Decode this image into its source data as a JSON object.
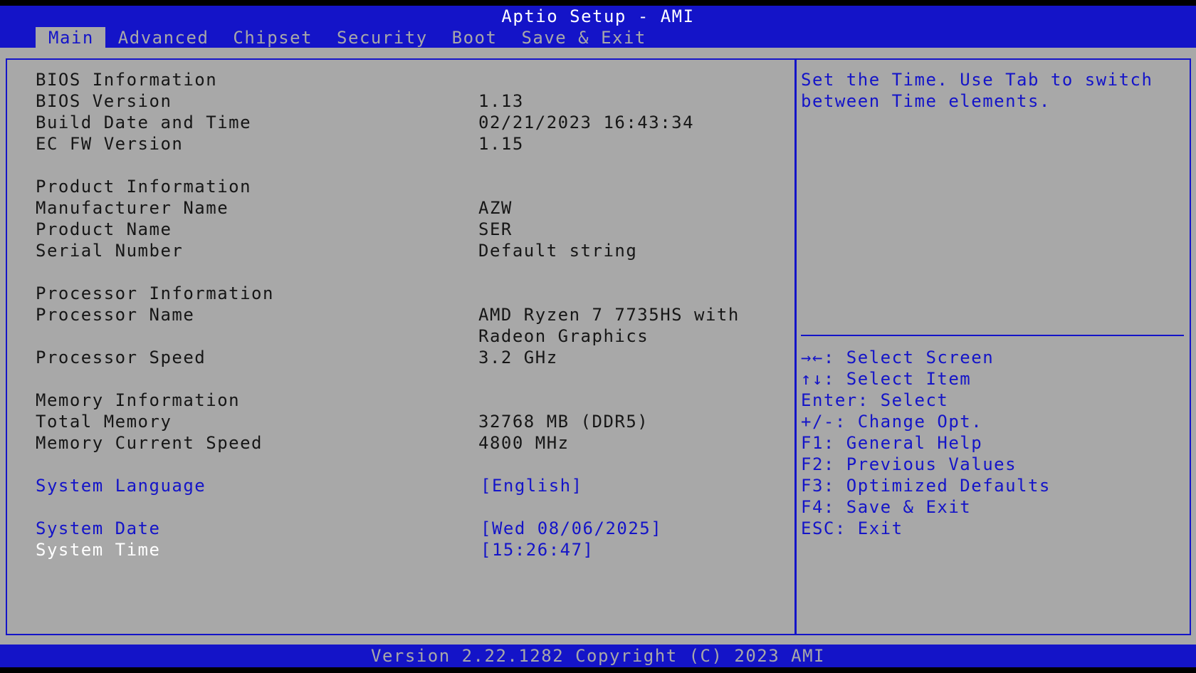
{
  "header": {
    "title": "Aptio Setup - AMI",
    "tabs": [
      "Main",
      "Advanced",
      "Chipset",
      "Security",
      "Boot",
      "Save & Exit"
    ],
    "active_tab": "Main"
  },
  "main": {
    "bios_info_heading": "BIOS Information",
    "bios_version_label": "BIOS Version",
    "bios_version_value": "1.13",
    "build_date_label": "Build Date and Time",
    "build_date_value": "02/21/2023 16:43:34",
    "ec_fw_label": "EC FW Version",
    "ec_fw_value": "1.15",
    "product_info_heading": "Product Information",
    "manufacturer_label": "Manufacturer Name",
    "manufacturer_value": "AZW",
    "product_name_label": "Product Name",
    "product_name_value": "SER",
    "serial_label": "Serial Number",
    "serial_value": "Default string",
    "processor_info_heading": "Processor Information",
    "processor_name_label": "Processor Name",
    "processor_name_value_line1": "AMD Ryzen 7 7735HS with",
    "processor_name_value_line2": "Radeon Graphics",
    "processor_speed_label": "Processor Speed",
    "processor_speed_value": "3.2 GHz",
    "memory_info_heading": "Memory Information",
    "total_memory_label": "Total Memory",
    "total_memory_value": "32768 MB (DDR5)",
    "memory_speed_label": "Memory Current Speed",
    "memory_speed_value": "4800 MHz",
    "language_label": "System Language",
    "language_value": "[English]",
    "date_label": "System Date",
    "date_value": "[Wed 08/06/2025]",
    "time_label": "System Time",
    "time_value": "[15:26:47]"
  },
  "help": {
    "text": "Set the Time. Use Tab to switch between Time elements.",
    "keys": [
      "→←: Select Screen",
      "↑↓: Select Item",
      "Enter: Select",
      "+/-: Change Opt.",
      "F1: General Help",
      "F2: Previous Values",
      "F3: Optimized Defaults",
      "F4: Save & Exit",
      "ESC: Exit"
    ]
  },
  "footer": {
    "text": "Version 2.22.1282 Copyright (C) 2023 AMI"
  },
  "colors": {
    "bios_blue": "#1414c8",
    "panel_gray": "#a8a8a8",
    "text_dark": "#161616",
    "selected_white": "#ffffff"
  }
}
